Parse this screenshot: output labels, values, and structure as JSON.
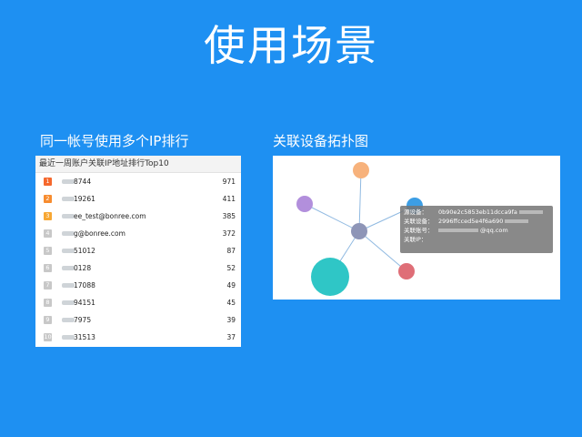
{
  "title": "使用场景",
  "left": {
    "caption": "同一帐号使用多个IP排行",
    "panel_title": "最近一周账户关联IP地址排行Top10",
    "rows": [
      {
        "rank": "1",
        "name": "8744",
        "value": "971",
        "color": "#f5682d"
      },
      {
        "rank": "2",
        "name": "19261",
        "value": "411",
        "color": "#f78c2f"
      },
      {
        "rank": "3",
        "name": "ee_test@bonree.com",
        "value": "385",
        "color": "#f7a733"
      },
      {
        "rank": "4",
        "name": "g@bonree.com",
        "value": "372",
        "color": "#c8c8c8"
      },
      {
        "rank": "5",
        "name": "51012",
        "value": "87",
        "color": "#c8c8c8"
      },
      {
        "rank": "6",
        "name": "0128",
        "value": "52",
        "color": "#c8c8c8"
      },
      {
        "rank": "7",
        "name": "17088",
        "value": "49",
        "color": "#c8c8c8"
      },
      {
        "rank": "8",
        "name": "94151",
        "value": "45",
        "color": "#c8c8c8"
      },
      {
        "rank": "9",
        "name": "7975",
        "value": "39",
        "color": "#c8c8c8"
      },
      {
        "rank": "10",
        "name": "31513",
        "value": "37",
        "color": "#c8c8c8"
      }
    ]
  },
  "right": {
    "caption": "关联设备拓扑图",
    "tooltip": {
      "rows": [
        {
          "label": "源设备：",
          "value": "0b90e2c5853eb11dcca9fa"
        },
        {
          "label": "关联设备：",
          "value": "2996ffcced5e4f6a690"
        },
        {
          "label": "关联账号：",
          "value": "@qq.com"
        },
        {
          "label": "关联IP：",
          "value": ""
        }
      ]
    },
    "nodes": [
      {
        "name": "center",
        "color": "#8e95b7"
      },
      {
        "name": "orange",
        "color": "#f7b27c"
      },
      {
        "name": "purple",
        "color": "#b28fdc"
      },
      {
        "name": "blue",
        "color": "#3c9ee5"
      },
      {
        "name": "teal",
        "color": "#2fc6c6"
      },
      {
        "name": "red",
        "color": "#df6e77"
      }
    ],
    "edge_color": "#8fb9e1"
  }
}
